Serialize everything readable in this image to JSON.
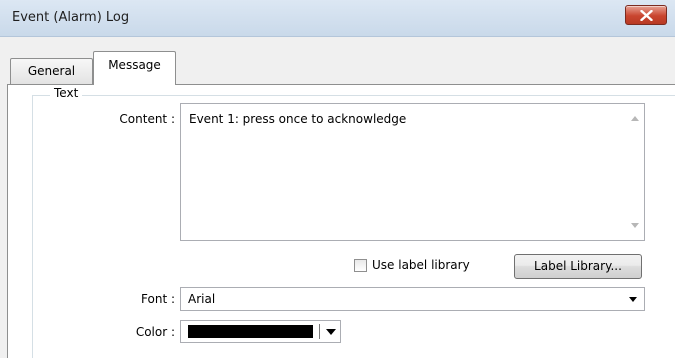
{
  "window": {
    "title": "Event (Alarm) Log"
  },
  "tabs": [
    {
      "label": "General",
      "active": false
    },
    {
      "label": "Message",
      "active": true
    }
  ],
  "text_group": {
    "label": "Text",
    "content_label": "Content :",
    "content_value": "Event 1: press once to acknowledge",
    "use_label_library_label": "Use label library",
    "use_label_library_checked": false,
    "label_library_button": "Label Library...",
    "font_label": "Font :",
    "font_value": "Arial",
    "color_label": "Color :",
    "color_value": "#000000"
  },
  "icons": {
    "close": "close-icon",
    "scroll_up": "scroll-up-arrow-icon",
    "scroll_down": "scroll-down-arrow-icon",
    "font_dropdown": "chevron-down-icon",
    "color_dropdown": "chevron-down-icon"
  },
  "colors": {
    "close_button": "#c9452f",
    "title_bar": "#dce7f3"
  }
}
